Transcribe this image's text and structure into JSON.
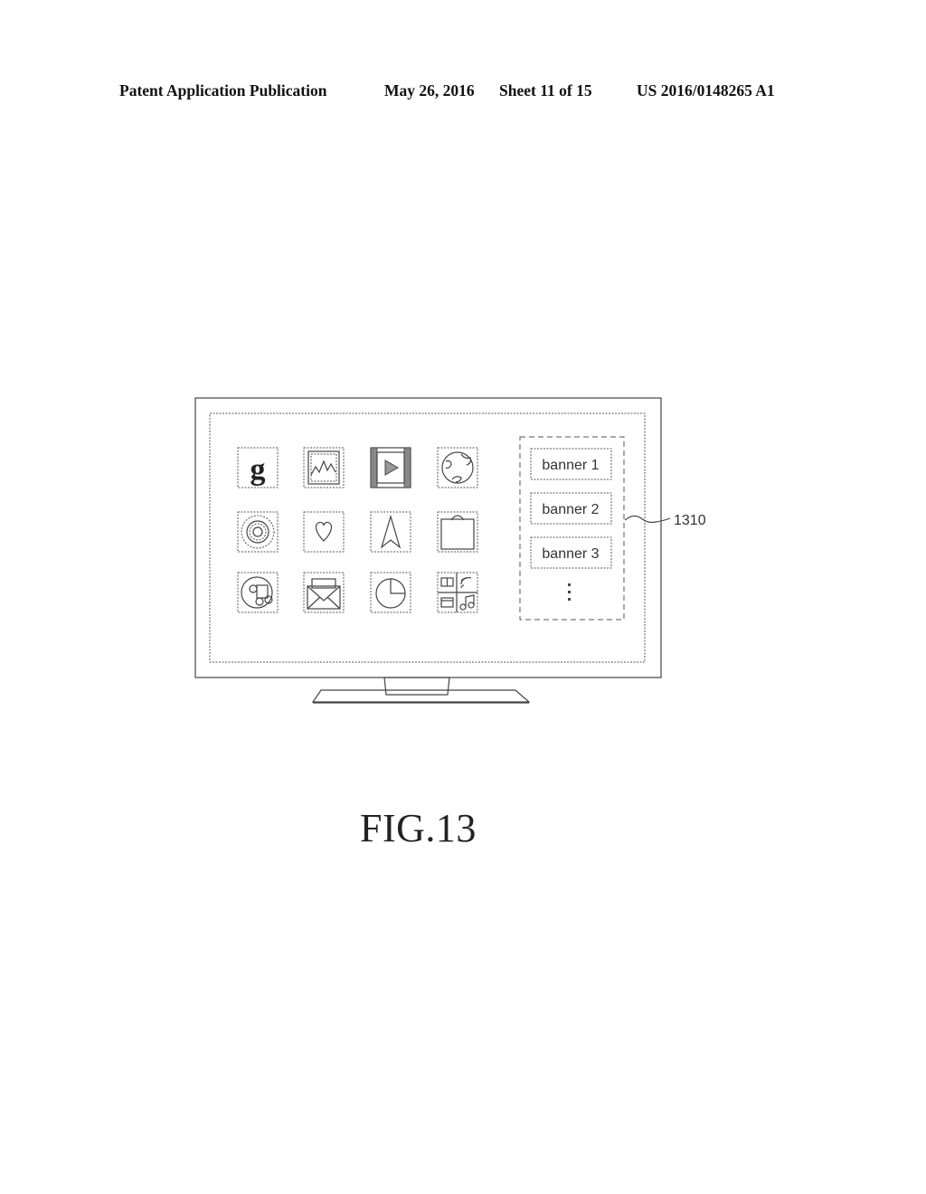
{
  "header": {
    "publication_type": "Patent Application Publication",
    "date": "May 26, 2016",
    "sheet": "Sheet 11 of 15",
    "publication_number": "US 2016/0148265 A1"
  },
  "figure": {
    "caption": "FIG.13",
    "device": "tv-display",
    "app_icons": [
      {
        "name": "g-letter-icon",
        "glyph": "g"
      },
      {
        "name": "gallery-chart-icon"
      },
      {
        "name": "video-play-icon"
      },
      {
        "name": "globe-icon"
      },
      {
        "name": "gear-icon"
      },
      {
        "name": "heart-icon"
      },
      {
        "name": "navigation-arrow-icon"
      },
      {
        "name": "shopping-bag-icon"
      },
      {
        "name": "music-disc-icon"
      },
      {
        "name": "envelope-icon"
      },
      {
        "name": "pie-chart-icon"
      },
      {
        "name": "multi-app-folder-icon"
      }
    ],
    "banner_area": {
      "reference_numeral": "1310",
      "banners": [
        "banner 1",
        "banner 2",
        "banner 3"
      ],
      "more_indicator": "⋮"
    }
  }
}
